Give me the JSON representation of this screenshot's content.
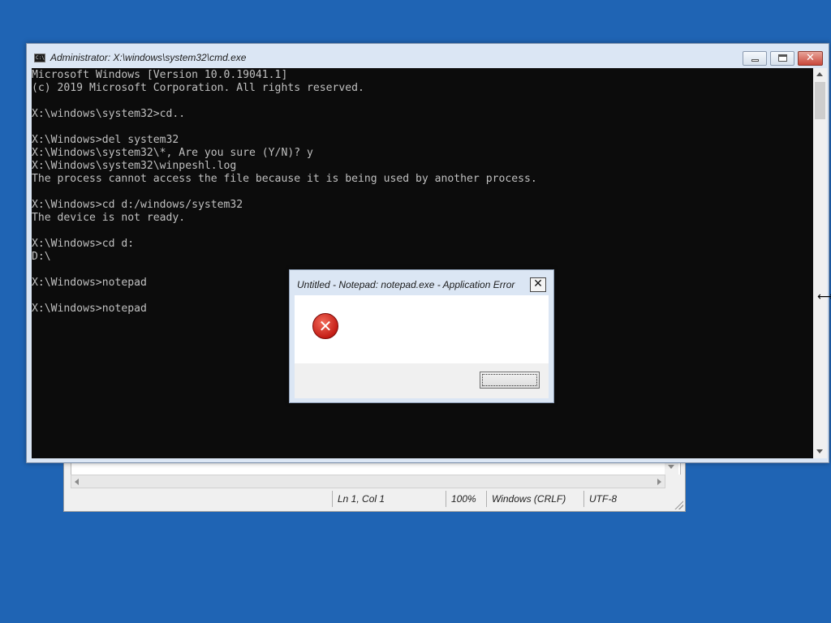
{
  "cmd_window": {
    "title": "Administrator: X:\\windows\\system32\\cmd.exe",
    "icon_text": "C:\\",
    "console_lines": [
      "Microsoft Windows [Version 10.0.19041.1]",
      "(c) 2019 Microsoft Corporation. All rights reserved.",
      "",
      "X:\\windows\\system32>cd..",
      "",
      "X:\\Windows>del system32",
      "X:\\Windows\\system32\\*, Are you sure (Y/N)? y",
      "X:\\Windows\\system32\\winpeshl.log",
      "The process cannot access the file because it is being used by another process.",
      "",
      "X:\\Windows>cd d:/windows/system32",
      "The device is not ready.",
      "",
      "X:\\Windows>cd d:",
      "D:\\",
      "",
      "X:\\Windows>notepad",
      "",
      "X:\\Windows>notepad"
    ],
    "close_glyph": "✕"
  },
  "notepad_status": {
    "position": "Ln 1, Col 1",
    "zoom": "100%",
    "line_ending": "Windows (CRLF)",
    "encoding": "UTF-8"
  },
  "error_dialog": {
    "title": "Untitled - Notepad: notepad.exe - Application Error",
    "close_glyph": "✕",
    "icon_glyph": "✕",
    "ok_label": ""
  },
  "cursor": {
    "glyph": "⟷"
  },
  "colors": {
    "desktop": "#1f64b4",
    "console_bg": "#0c0c0c",
    "console_fg": "#c0c0c0"
  }
}
